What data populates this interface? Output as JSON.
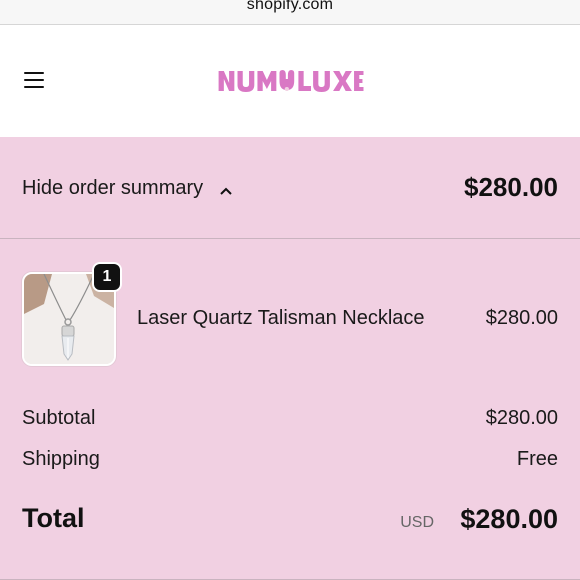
{
  "browser": {
    "url": "shopify.com"
  },
  "header": {
    "logo_text": "NUMOLUXE",
    "menu_icon": "hamburger-menu-icon"
  },
  "summary_toggle": {
    "label": "Hide order summary",
    "icon": "chevron-up-icon",
    "total": "$280.00"
  },
  "line_items": [
    {
      "name": "Laser Quartz Talisman Necklace",
      "quantity": "1",
      "price": "$280.00"
    }
  ],
  "totals": {
    "subtotal_label": "Subtotal",
    "subtotal_value": "$280.00",
    "shipping_label": "Shipping",
    "shipping_value": "Free",
    "total_label": "Total",
    "currency": "USD",
    "total_value": "$280.00"
  },
  "colors": {
    "summary_bg": "#f1d0e2",
    "logo": "#d978c4",
    "badge": "#111111"
  }
}
